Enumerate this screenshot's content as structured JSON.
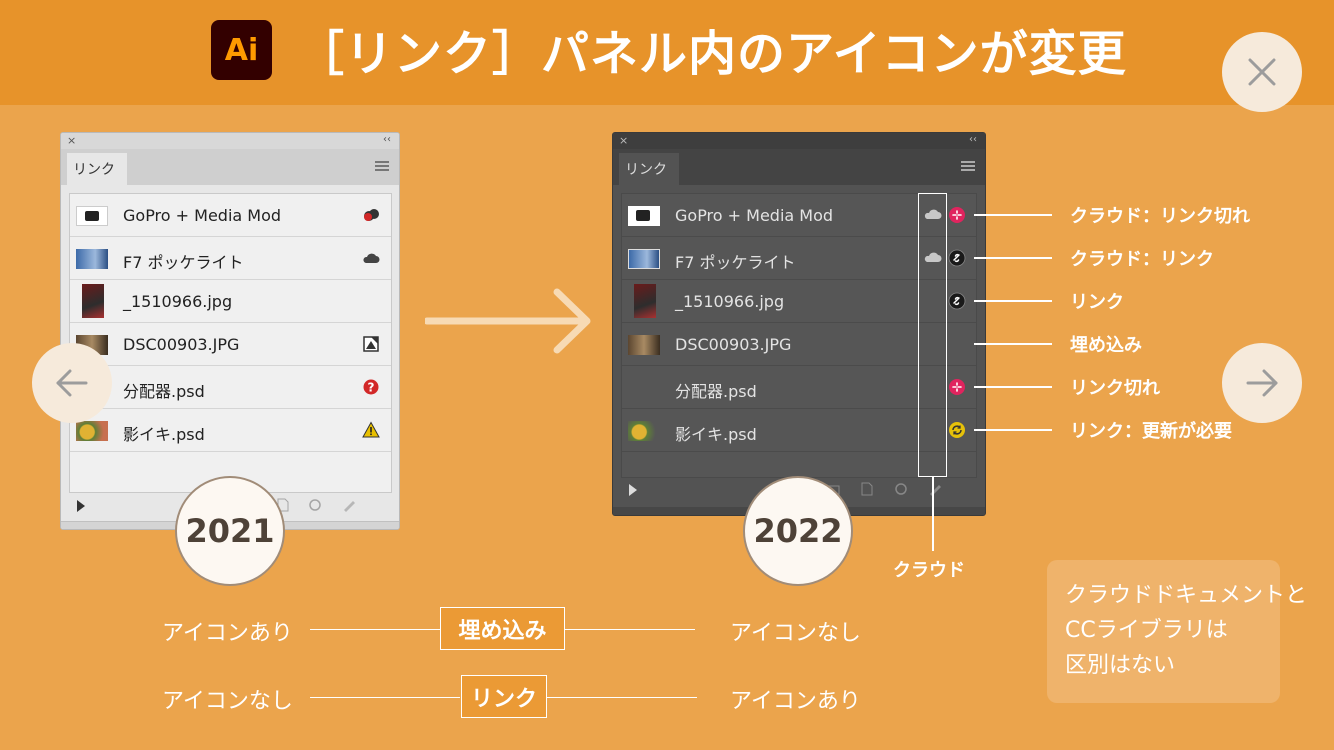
{
  "header": {
    "logo_text": "Ai",
    "title": "［リンク］パネル内のアイコンが変更",
    "background": "#e7932a"
  },
  "nav": {
    "close_icon": "close-icon",
    "prev_icon": "arrow-left-icon",
    "next_icon": "arrow-right-icon"
  },
  "panel_2021": {
    "close_glyph": "×",
    "collapse_glyph": "‹‹",
    "tab_label": "リンク",
    "items": [
      {
        "name": "GoPro + Media Mod",
        "status": "cloud-link-broken-icon"
      },
      {
        "name": "F7 ポッケライト",
        "status": "cloud-icon"
      },
      {
        "name": "_1510966.jpg",
        "status": ""
      },
      {
        "name": "DSC00903.JPG",
        "status": "embedded-icon"
      },
      {
        "name": "分配器.psd",
        "status": "missing-link-icon"
      },
      {
        "name": "影イキ.psd",
        "status": "modified-warning-icon"
      }
    ]
  },
  "panel_2022": {
    "close_glyph": "×",
    "collapse_glyph": "‹‹",
    "tab_label": "リンク",
    "items": [
      {
        "name": "GoPro + Media Mod",
        "cloud": true,
        "status": "broken-link-icon"
      },
      {
        "name": "F7 ポッケライト",
        "cloud": true,
        "status": "link-icon"
      },
      {
        "name": "_1510966.jpg",
        "cloud": false,
        "status": "link-icon"
      },
      {
        "name": "DSC00903.JPG",
        "cloud": false,
        "status": ""
      },
      {
        "name": "分配器.psd",
        "cloud": false,
        "status": "broken-link-icon"
      },
      {
        "name": "影イキ.psd",
        "cloud": false,
        "status": "update-needed-icon"
      }
    ]
  },
  "years": {
    "left": "2021",
    "right": "2022"
  },
  "legend": {
    "cloud_broken": "クラウド：リンク切れ",
    "cloud_link": "クラウド：リンク",
    "link": "リンク",
    "embedded": "埋め込み",
    "broken": "リンク切れ",
    "update": "リンク：更新が必要",
    "cloud_column": "クラウド"
  },
  "comparison": [
    {
      "left": "アイコンあり",
      "center": "埋め込み",
      "right": "アイコンなし"
    },
    {
      "left": "アイコンなし",
      "center": "リンク",
      "right": "アイコンあり"
    }
  ],
  "note": {
    "line1": "クラウドドキュメントと",
    "line2": "CCライブラリは",
    "line3": "区別はない"
  },
  "colors": {
    "background": "#eba44c",
    "header": "#e7932a",
    "broken_link": "#e0245e",
    "update": "#e6c10a",
    "missing": "#d22828",
    "warning": "#e8c000"
  }
}
